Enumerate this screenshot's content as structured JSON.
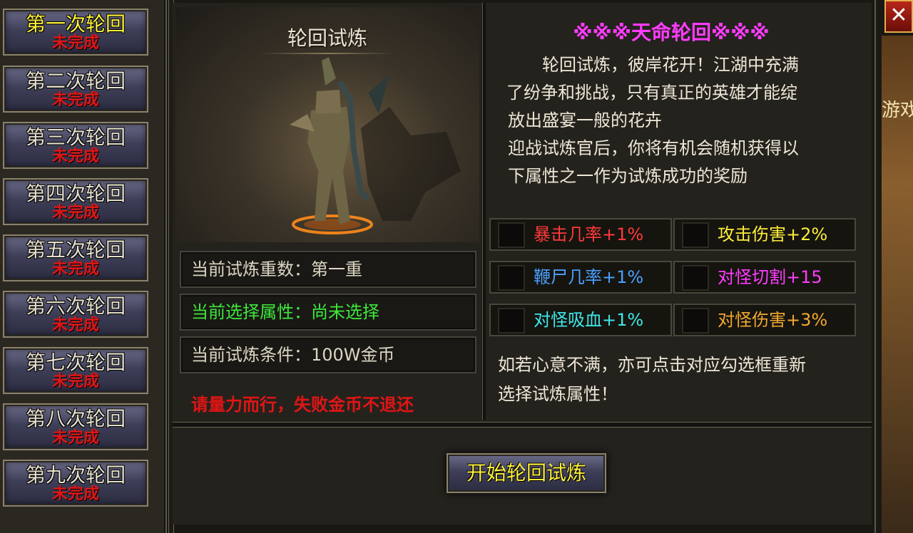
{
  "cycles": [
    {
      "title": "第一次轮回",
      "status": "未完成"
    },
    {
      "title": "第二次轮回",
      "status": "未完成"
    },
    {
      "title": "第三次轮回",
      "status": "未完成"
    },
    {
      "title": "第四次轮回",
      "status": "未完成"
    },
    {
      "title": "第五次轮回",
      "status": "未完成"
    },
    {
      "title": "第六次轮回",
      "status": "未完成"
    },
    {
      "title": "第七次轮回",
      "status": "未完成"
    },
    {
      "title": "第八次轮回",
      "status": "未完成"
    },
    {
      "title": "第九次轮回",
      "status": "未完成"
    }
  ],
  "portrait": {
    "title": "轮回试炼"
  },
  "info": {
    "level": "当前试炼重数：第一重",
    "selected": "当前选择属性：尚未选择",
    "condition": "当前试炼条件：100W金币"
  },
  "warning": "请量力而行，失败金币不退还",
  "right": {
    "title": "※※※天命轮回※※※",
    "desc_lines": [
      "　　轮回试炼，彼岸花开！江湖中充满",
      "了纷争和挑战，只有真正的英雄才能绽",
      "放出盛宴一般的花卉",
      "迎战试炼官后，你将有机会随机获得以",
      "下属性之一作为试炼成功的奖励"
    ],
    "attributes": [
      {
        "label": "暴击几率+1%",
        "color": "#ff3a3a"
      },
      {
        "label": "攻击伤害+2%",
        "color": "#ffee3c"
      },
      {
        "label": "鞭尸几率+1%",
        "color": "#4aa0ff"
      },
      {
        "label": "对怪切割+15",
        "color": "#ff3cff"
      },
      {
        "label": "对怪吸血+1%",
        "color": "#3ce8e8"
      },
      {
        "label": "对怪伤害+3%",
        "color": "#f0a830"
      }
    ],
    "note_lines": [
      "如若心意不满，亦可点击对应勾选框重新",
      "选择试炼属性！"
    ]
  },
  "start_button": "开始轮回试炼",
  "side_text": "游戏",
  "close_icon": "✕",
  "colors": {
    "active_title": "#fff23a",
    "status": "#e01515",
    "selected_info": "#3ce83c"
  }
}
